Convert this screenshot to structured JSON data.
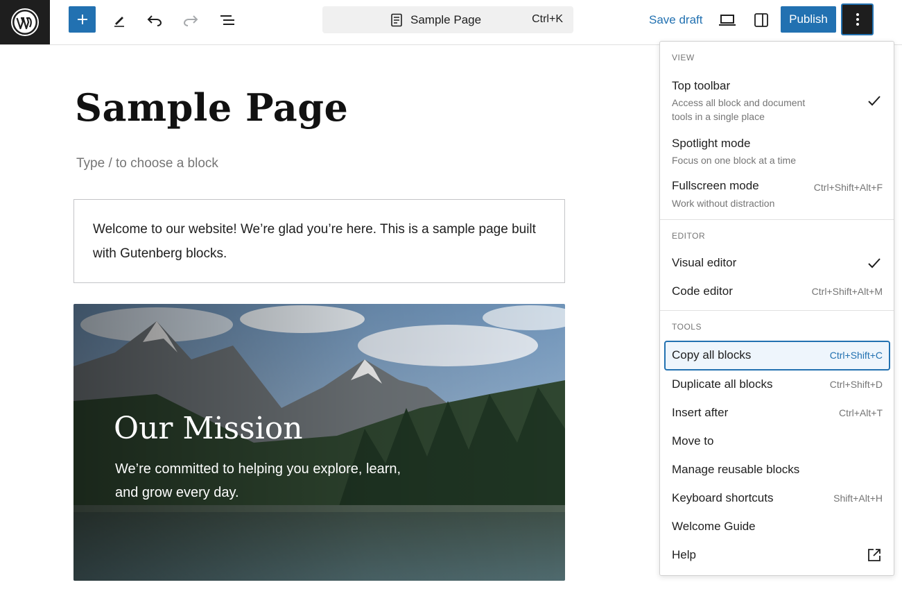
{
  "toolbar": {
    "document_title": "Sample Page",
    "command_shortcut": "Ctrl+K",
    "save_draft": "Save draft",
    "publish": "Publish"
  },
  "editor": {
    "title": "Sample Page",
    "placeholder": "Type / to choose a block",
    "paragraph": "Welcome to our website! We’re glad you’re here. This is a sample page built with Gutenberg blocks.",
    "cover": {
      "heading": "Our Mission",
      "text": "We’re committed to helping you explore, learn, and grow every day."
    }
  },
  "menu": {
    "view": {
      "label": "VIEW",
      "items": [
        {
          "label": "Top toolbar",
          "description": "Access all block and document tools in a single place",
          "checked": true
        },
        {
          "label": "Spotlight mode",
          "description": "Focus on one block at a time"
        },
        {
          "label": "Fullscreen mode",
          "description": "Work without distraction",
          "shortcut": "Ctrl+Shift+Alt+F"
        }
      ]
    },
    "editor": {
      "label": "EDITOR",
      "items": [
        {
          "label": "Visual editor",
          "checked": true
        },
        {
          "label": "Code editor",
          "shortcut": "Ctrl+Shift+Alt+M"
        }
      ]
    },
    "tools": {
      "label": "TOOLS",
      "items": [
        {
          "label": "Copy all blocks",
          "shortcut": "Ctrl+Shift+C"
        },
        {
          "label": "Duplicate all blocks",
          "shortcut": "Ctrl+Shift+D"
        },
        {
          "label": "Insert after",
          "shortcut": "Ctrl+Alt+T"
        },
        {
          "label": "Move to"
        },
        {
          "label": "Manage reusable blocks"
        },
        {
          "label": "Keyboard shortcuts",
          "shortcut": "Shift+Alt+H"
        },
        {
          "label": "Welcome Guide"
        },
        {
          "label": "Help"
        }
      ]
    }
  },
  "colors": {
    "accent": "#2271b1",
    "dark": "#1e1e1e"
  }
}
